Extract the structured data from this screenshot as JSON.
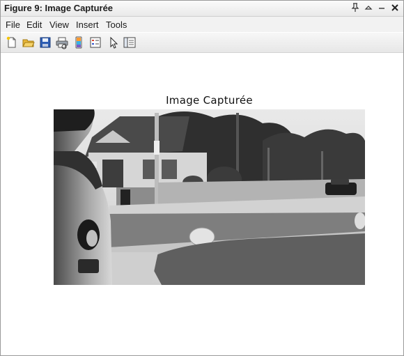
{
  "window": {
    "title": "Figure 9: Image Capturée",
    "controls": [
      "pin-icon",
      "restore-icon",
      "minimize-icon",
      "close-icon"
    ]
  },
  "menu": {
    "items": [
      "File",
      "Edit",
      "View",
      "Insert",
      "Tools"
    ]
  },
  "toolbar": {
    "buttons": [
      {
        "name": "new-figure-icon"
      },
      {
        "name": "open-file-icon"
      },
      {
        "name": "save-icon"
      },
      {
        "name": "print-icon"
      },
      {
        "name": "link-plot-icon"
      },
      {
        "name": "insert-legend-icon"
      },
      {
        "name": "pointer-icon"
      },
      {
        "name": "dock-panel-icon"
      }
    ]
  },
  "axes": {
    "title": "Image Capturée"
  },
  "colors": {
    "titlebar_top": "#fbfbfb",
    "titlebar_bottom": "#e9e9e9",
    "menubar": "#f2f2f2",
    "background": "#ffffff"
  }
}
